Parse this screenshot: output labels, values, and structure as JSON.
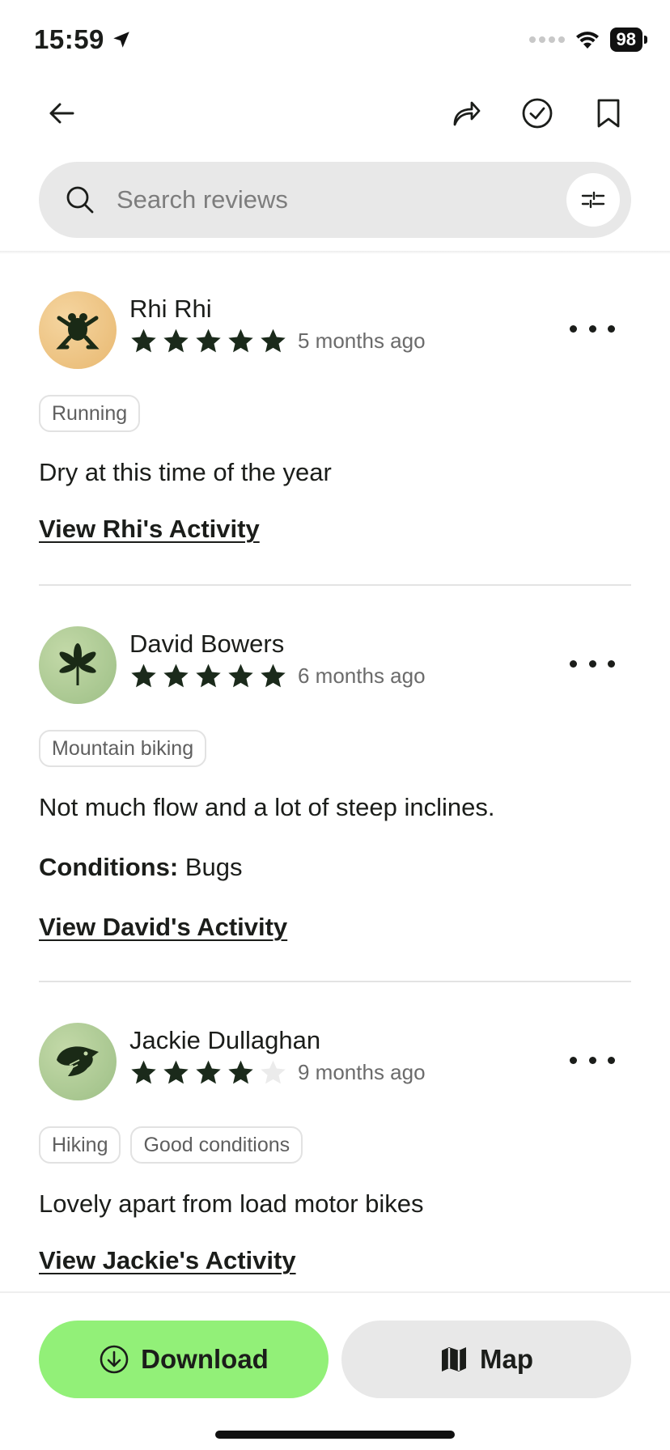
{
  "status_bar": {
    "time": "15:59",
    "battery": "98"
  },
  "search": {
    "placeholder": "Search reviews"
  },
  "reviews": [
    {
      "name": "Rhi Rhi",
      "rating": 5,
      "date": "5 months ago",
      "avatar_icon": "frog-icon",
      "tags": [
        "Running"
      ],
      "text": "Dry at this time of the year",
      "activity_link": "View Rhi's Activity"
    },
    {
      "name": "David Bowers",
      "rating": 5,
      "date": "6 months ago",
      "avatar_icon": "leaf-icon",
      "tags": [
        "Mountain biking"
      ],
      "text": "Not much flow and a lot of steep inclines.",
      "conditions_label": "Conditions:",
      "conditions_value": "Bugs",
      "activity_link": "View David's Activity"
    },
    {
      "name": "Jackie Dullaghan",
      "rating": 4,
      "date": "9 months ago",
      "avatar_icon": "eagle-icon",
      "tags": [
        "Hiking",
        "Good conditions"
      ],
      "text": "Lovely apart from load motor bikes",
      "activity_link": "View Jackie's Activity"
    }
  ],
  "bottom": {
    "download_label": "Download",
    "map_label": "Map"
  },
  "colors": {
    "accent_green": "#92f078",
    "text_dark": "#1b1d1a",
    "star_filled": "#1b2a1b",
    "star_empty": "#ebebeb"
  }
}
